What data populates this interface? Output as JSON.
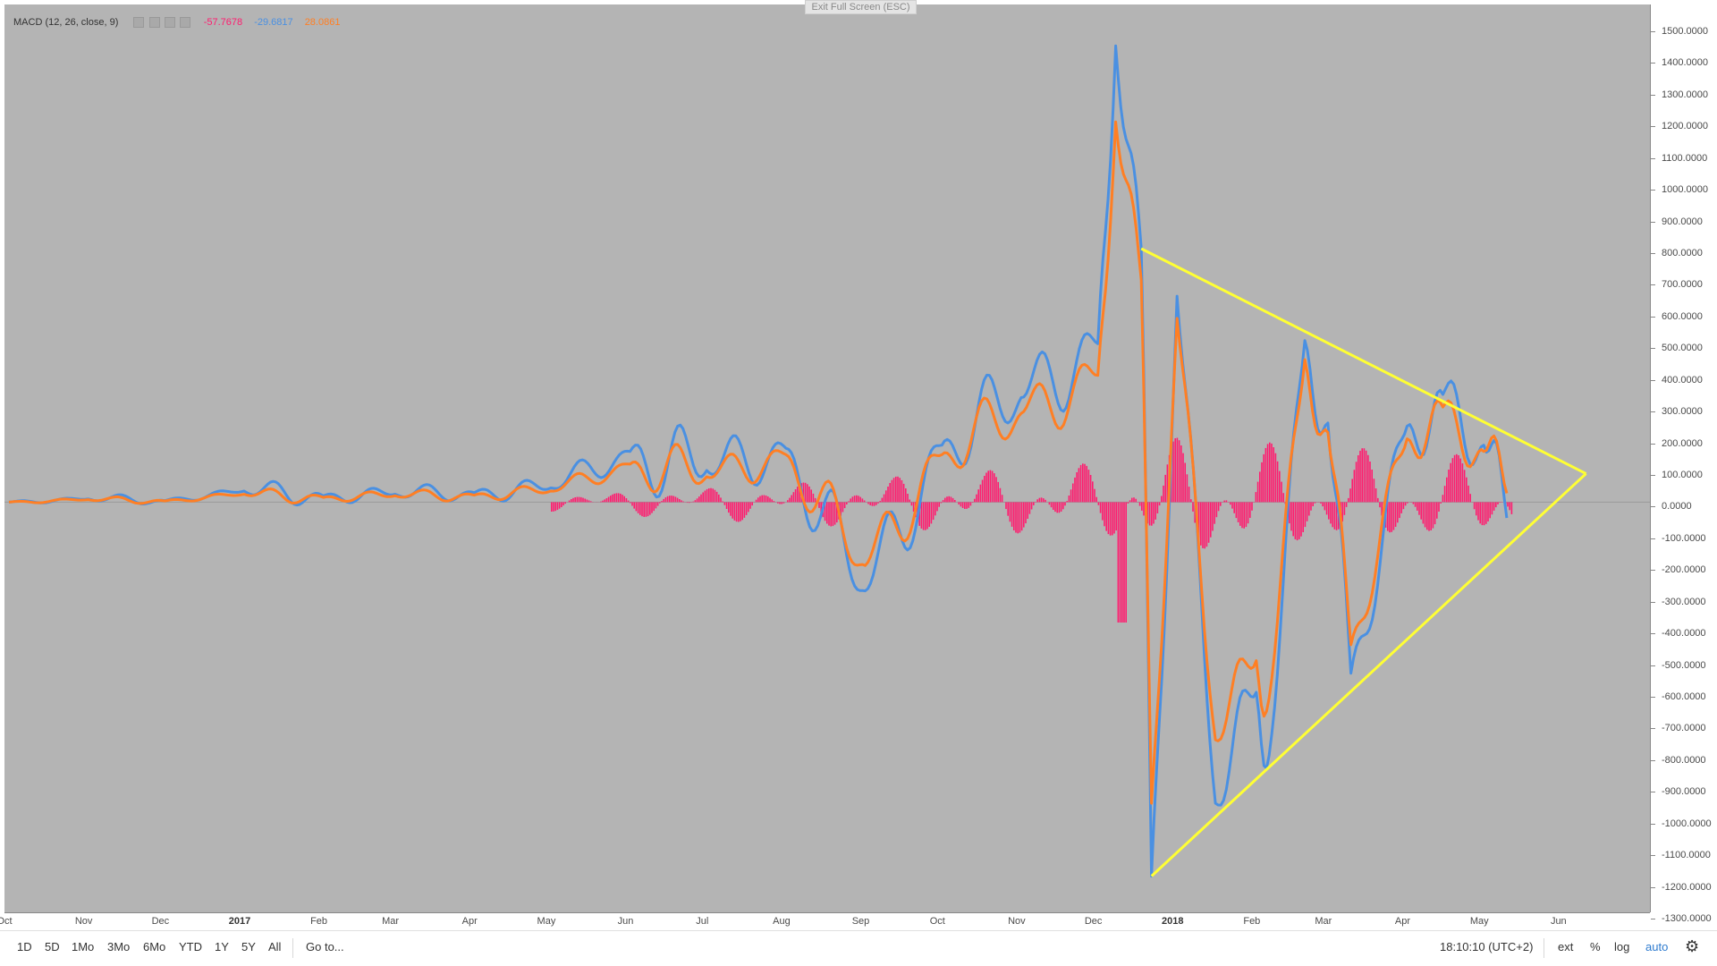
{
  "indicator": {
    "name": "MACD (12, 26, close, 9)",
    "histogram_value": "-57.7678",
    "macd_value": "-29.6817",
    "signal_value": "28.0861"
  },
  "exit_fullscreen_label": "Exit Full Screen (ESC)",
  "colors": {
    "background": "#b4b4b4",
    "histogram": "#ff1c6f",
    "macd": "#4a90e2",
    "signal": "#ff7f24",
    "trendline": "#ffff33"
  },
  "icons": [
    "settings-icon",
    "eye-icon",
    "plus-icon",
    "close-icon",
    "gear-icon"
  ],
  "price_ticks": [
    "1500.0000",
    "1400.0000",
    "1300.0000",
    "1200.0000",
    "1100.0000",
    "1000.0000",
    "900.0000",
    "800.0000",
    "700.0000",
    "600.0000",
    "500.0000",
    "400.0000",
    "300.0000",
    "200.0000",
    "100.0000",
    "0.0000",
    "-100.0000",
    "-200.0000",
    "-300.0000",
    "-400.0000",
    "-500.0000",
    "-600.0000",
    "-700.0000",
    "-800.0000",
    "-900.0000",
    "-1000.0000",
    "-1100.0000",
    "-1200.0000",
    "-1300.0000"
  ],
  "price_values": [
    1500,
    1400,
    1300,
    1200,
    1100,
    1000,
    900,
    800,
    700,
    600,
    500,
    400,
    300,
    200,
    100,
    0,
    -100,
    -200,
    -300,
    -400,
    -500,
    -600,
    -700,
    -800,
    -900,
    -1000,
    -1100,
    -1200,
    -1300
  ],
  "time_ticks": [
    {
      "label": "Oct",
      "year": false
    },
    {
      "label": "Nov",
      "year": false
    },
    {
      "label": "Dec",
      "year": false
    },
    {
      "label": "2017",
      "year": true
    },
    {
      "label": "Feb",
      "year": false
    },
    {
      "label": "Mar",
      "year": false
    },
    {
      "label": "Apr",
      "year": false
    },
    {
      "label": "May",
      "year": false
    },
    {
      "label": "Jun",
      "year": false
    },
    {
      "label": "Jul",
      "year": false
    },
    {
      "label": "Aug",
      "year": false
    },
    {
      "label": "Sep",
      "year": false
    },
    {
      "label": "Oct",
      "year": false
    },
    {
      "label": "Nov",
      "year": false
    },
    {
      "label": "Dec",
      "year": false
    },
    {
      "label": "2018",
      "year": true
    },
    {
      "label": "Feb",
      "year": false
    },
    {
      "label": "Mar",
      "year": false
    },
    {
      "label": "Apr",
      "year": false
    },
    {
      "label": "May",
      "year": false
    },
    {
      "label": "Jun",
      "year": false
    }
  ],
  "bottom_bar": {
    "ranges": [
      "1D",
      "5D",
      "1Mo",
      "3Mo",
      "6Mo",
      "YTD",
      "1Y",
      "5Y",
      "All"
    ],
    "goto": "Go to...",
    "clock": "18:10:10 (UTC+2)",
    "ext": "ext",
    "percent": "%",
    "log": "log",
    "auto": "auto"
  },
  "chart_data": {
    "type": "line",
    "title": "",
    "xlabel": "",
    "ylabel": "",
    "ylim": [
      -1300,
      1500
    ],
    "x_range": [
      "2016-10",
      "2018-06"
    ],
    "series": [
      {
        "name": "MACD",
        "color": "#4a90e2",
        "x": [
          "2016-10",
          "2016-11",
          "2016-12",
          "2017-01",
          "2017-02",
          "2017-03",
          "2017-04",
          "2017-05",
          "2017-06",
          "2017-07",
          "2017-08",
          "2017-09",
          "2017-10",
          "2017-11",
          "2017-12",
          "2017-12-08",
          "2017-12-18",
          "2017-12-22",
          "2018-01",
          "2018-01-16",
          "2018-02",
          "2018-02-06",
          "2018-02-20",
          "2018-03",
          "2018-03-10",
          "2018-04",
          "2018-04-15",
          "2018-05",
          "2018-05-10"
        ],
        "values": [
          0,
          10,
          5,
          35,
          20,
          25,
          30,
          45,
          160,
          100,
          170,
          -280,
          180,
          330,
          500,
          1440,
          800,
          -1180,
          650,
          -950,
          -600,
          -800,
          510,
          250,
          -540,
          240,
          340,
          180,
          -50
        ]
      },
      {
        "name": "Signal",
        "color": "#ff7f24",
        "x": [
          "2016-10",
          "2016-11",
          "2016-12",
          "2017-01",
          "2017-02",
          "2017-03",
          "2017-04",
          "2017-05",
          "2017-06",
          "2017-07",
          "2017-08",
          "2017-09",
          "2017-10",
          "2017-11",
          "2017-12",
          "2017-12-08",
          "2017-12-18",
          "2017-12-22",
          "2018-01",
          "2018-01-16",
          "2018-02",
          "2018-02-06",
          "2018-02-20",
          "2018-03",
          "2018-03-10",
          "2018-04",
          "2018-04-15",
          "2018-05",
          "2018-05-10"
        ],
        "values": [
          0,
          8,
          4,
          25,
          15,
          20,
          22,
          35,
          120,
          80,
          150,
          -200,
          150,
          280,
          400,
          1200,
          700,
          -950,
          580,
          -750,
          -500,
          -620,
          450,
          220,
          -450,
          200,
          300,
          160,
          28
        ]
      },
      {
        "name": "Histogram",
        "color": "#ff1c6f",
        "x": [
          "2017-06",
          "2017-09",
          "2017-12",
          "2017-12-10",
          "2018-01",
          "2018-02",
          "2018-03",
          "2018-04",
          "2018-05"
        ],
        "values": [
          20,
          -60,
          300,
          -400,
          310,
          250,
          200,
          120,
          -58
        ]
      }
    ],
    "trendlines": [
      {
        "from": [
          "2017-12-18",
          800
        ],
        "to": [
          "2018-06-10",
          90
        ]
      },
      {
        "from": [
          "2017-12-22",
          -1180
        ],
        "to": [
          "2018-06-10",
          90
        ]
      }
    ]
  }
}
